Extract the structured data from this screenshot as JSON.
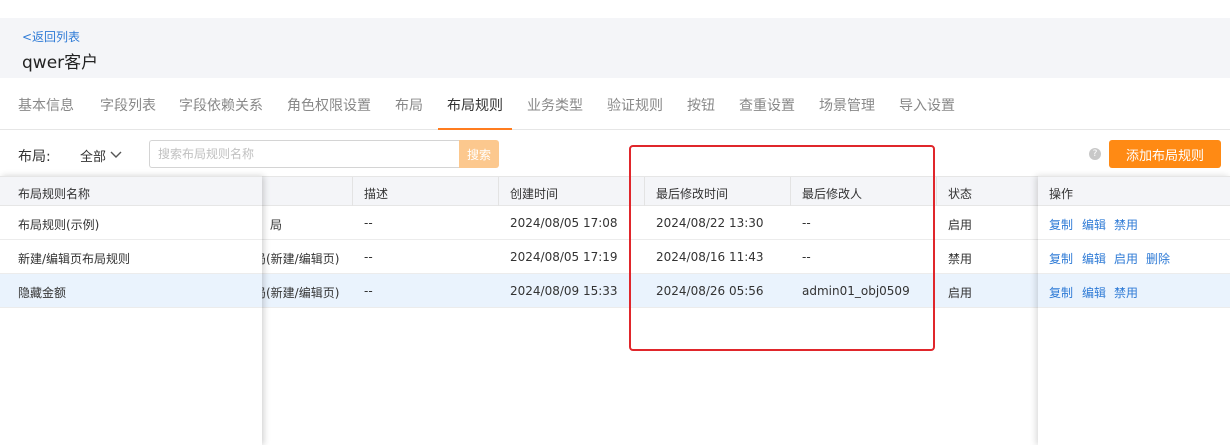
{
  "header": {
    "back_label": "<返回列表",
    "title": "qwer客户"
  },
  "tabs": [
    {
      "label": "基本信息",
      "active": false
    },
    {
      "label": "字段列表",
      "active": false
    },
    {
      "label": "字段依赖关系",
      "active": false
    },
    {
      "label": "角色权限设置",
      "active": false
    },
    {
      "label": "布局",
      "active": false
    },
    {
      "label": "布局规则",
      "active": true
    },
    {
      "label": "业务类型",
      "active": false
    },
    {
      "label": "验证规则",
      "active": false
    },
    {
      "label": "按钮",
      "active": false
    },
    {
      "label": "查重设置",
      "active": false
    },
    {
      "label": "场景管理",
      "active": false
    },
    {
      "label": "导入设置",
      "active": false
    }
  ],
  "toolbar": {
    "filter_label": "布局:",
    "filter_value": "全部",
    "search_placeholder": "搜索布局规则名称",
    "search_label": "搜索",
    "help_label": "?",
    "add_label": "添加布局规则"
  },
  "table": {
    "columns": {
      "name": "布局规则名称",
      "desc": "描述",
      "created": "创建时间",
      "modified": "最后修改时间",
      "modifier": "最后修改人",
      "status": "状态",
      "actions": "操作"
    },
    "rows": [
      {
        "name": "布局规则(示例)",
        "layout": "局",
        "desc": "--",
        "created": "2024/08/05 17:08",
        "modified": "2024/08/22 13:30",
        "modifier": "--",
        "status": "启用",
        "ops": [
          "复制",
          "编辑",
          "禁用"
        ]
      },
      {
        "name": "新建/编辑页布局规则",
        "layout": "局(新建/编辑页)",
        "desc": "--",
        "created": "2024/08/05 17:19",
        "modified": "2024/08/16 11:43",
        "modifier": "--",
        "status": "禁用",
        "ops": [
          "复制",
          "编辑",
          "启用",
          "删除"
        ]
      },
      {
        "name": "隐藏金额",
        "layout": "局(新建/编辑页)",
        "desc": "--",
        "created": "2024/08/09 15:33",
        "modified": "2024/08/26 05:56",
        "modifier": "admin01_obj0509",
        "status": "启用",
        "ops": [
          "复制",
          "编辑",
          "禁用"
        ]
      }
    ]
  },
  "colors": {
    "accent": "#ff8a14",
    "link": "#2f7bd6",
    "annotation": "#e0262b",
    "row_highlight": "#eaf3fd"
  }
}
